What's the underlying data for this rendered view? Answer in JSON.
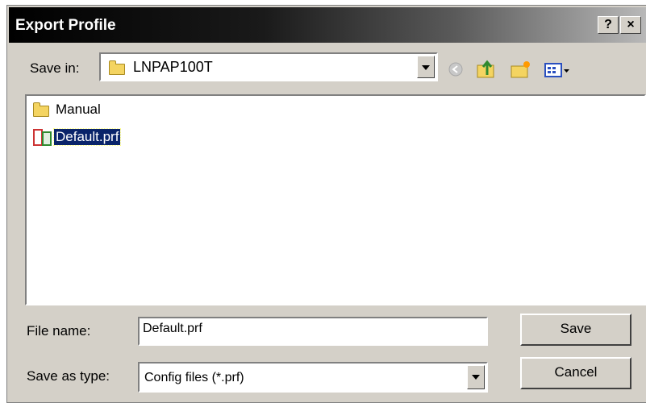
{
  "window": {
    "title": "Export Profile"
  },
  "title_buttons": {
    "help": "?",
    "close": "×"
  },
  "save_in": {
    "label": "Save in:",
    "value": "LNPAP100T"
  },
  "toolbar": [
    "back-icon",
    "up-folder-icon",
    "new-folder-icon",
    "view-menu-icon"
  ],
  "files": [
    {
      "name": "Manual",
      "icon": "folder-icon",
      "selected": false
    },
    {
      "name": "Default.prf",
      "icon": "profile-file-icon",
      "selected": true
    }
  ],
  "file_name": {
    "label": "File name:",
    "value": "Default.prf"
  },
  "save_as_type": {
    "label": "Save as type:",
    "value": "Config files (*.prf)"
  },
  "buttons": {
    "save": "Save",
    "cancel": "Cancel"
  },
  "colors": {
    "selection": "#0a246a",
    "dialog": "#d4d0c8"
  }
}
